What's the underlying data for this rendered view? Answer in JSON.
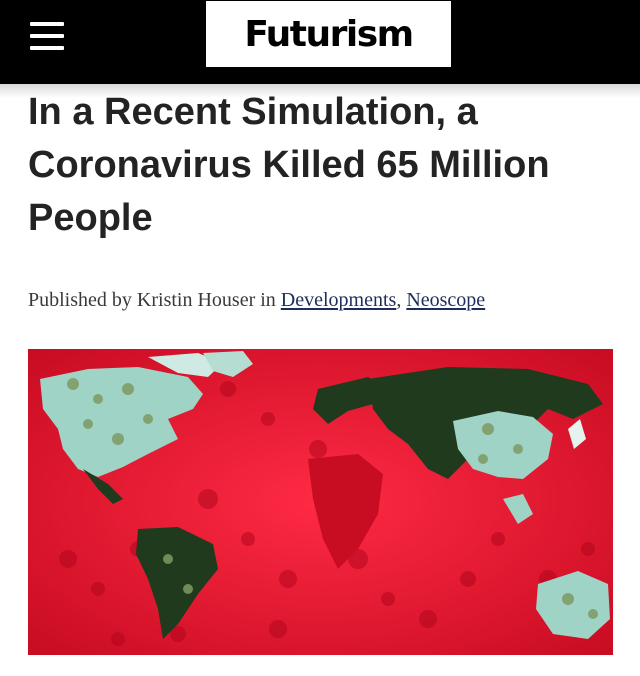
{
  "header": {
    "logo": "Futurism",
    "menu_icon": "hamburger-menu-icon",
    "background": "#000000"
  },
  "article": {
    "title": "In a Recent Simulation, a Coronavirus Killed 65 Million People",
    "byline": {
      "prefix": "Published by",
      "author": "Kristin Houser",
      "in_word": "in",
      "categories": [
        "Developments",
        "Neoscope"
      ],
      "separator": ","
    },
    "hero_image": {
      "subject": "world-map-outbreak-illustration",
      "colors": {
        "ocean": "#e8102a",
        "infected_land": "#1f3a1c",
        "hotspot_land": "#9fd3c6"
      }
    }
  }
}
